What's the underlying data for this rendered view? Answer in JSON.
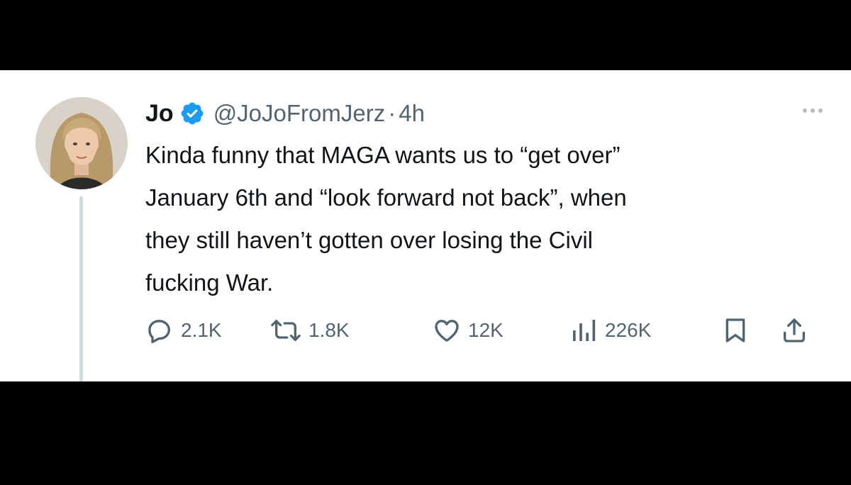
{
  "tweet": {
    "display_name": "Jo",
    "verified": true,
    "handle": "@JoJoFromJerz",
    "separator": "·",
    "time": "4h",
    "text": "Kinda funny that MAGA wants us to “get over”\nJanuary 6th and “look forward not back”, when\nthey still haven’t gotten over losing the Civil\nfucking War."
  },
  "actions": {
    "replies": "2.1K",
    "retweets": "1.8K",
    "likes": "12K",
    "views": "226K"
  },
  "icons": {
    "verified": "verified-badge-icon",
    "more": "more-options-icon",
    "reply": "reply-bubble-icon",
    "retweet": "retweet-icon",
    "like": "heart-icon",
    "views": "analytics-bars-icon",
    "bookmark": "bookmark-icon",
    "share": "share-upload-icon"
  },
  "colors": {
    "verified_blue": "#1d9bf0",
    "text_primary": "#0f1419",
    "text_secondary": "#536471",
    "thread_line": "#cfd9de",
    "letterbox": "#000000",
    "card_background": "#ffffff"
  }
}
